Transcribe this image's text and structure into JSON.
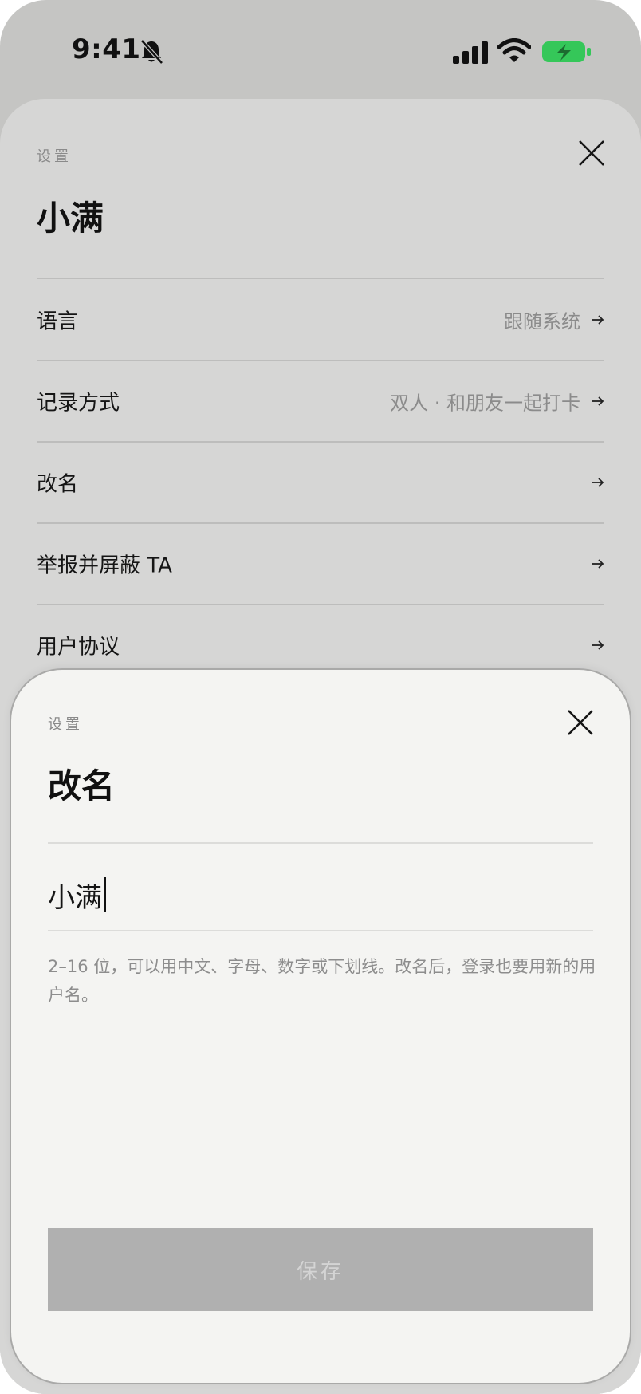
{
  "status_bar": {
    "time": "9:41",
    "icons": [
      "bell-slash-icon",
      "signal-icon",
      "wifi-icon",
      "battery-charging-icon"
    ],
    "battery_color": "#35c759"
  },
  "settings_sheet": {
    "caption": "设置",
    "title": "小满",
    "rows": [
      {
        "label": "语言",
        "value": "跟随系统"
      },
      {
        "label": "记录方式",
        "value": "双人 · 和朋友一起打卡"
      },
      {
        "label": "改名",
        "value": ""
      },
      {
        "label": "举报并屏蔽 TA",
        "value": ""
      },
      {
        "label": "用户协议",
        "value": ""
      }
    ]
  },
  "rename_sheet": {
    "caption": "设置",
    "title": "改名",
    "name_value": "小满",
    "hint": "2–16 位，可以用中文、字母、数字或下划线。改名后，登录也要用新的用户名。",
    "save_label": "保存"
  }
}
